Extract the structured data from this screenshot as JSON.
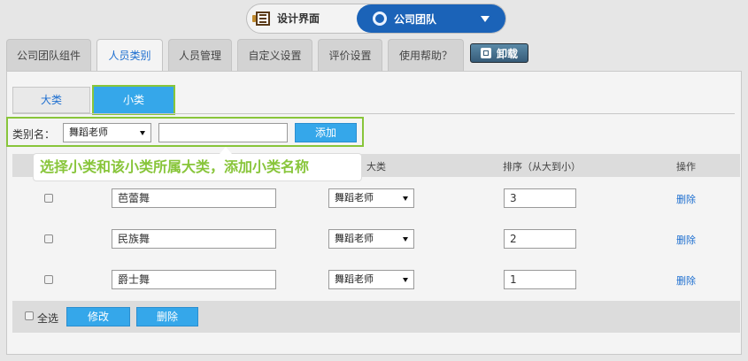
{
  "mode_switch": {
    "design_label": "设计界面",
    "team_label": "公司团队"
  },
  "tabs": [
    {
      "label": "公司团队组件"
    },
    {
      "label": "人员类别"
    },
    {
      "label": "人员管理"
    },
    {
      "label": "自定义设置"
    },
    {
      "label": "评价设置"
    },
    {
      "label": "使用帮助？"
    }
  ],
  "unload_label": "卸载",
  "subtabs": {
    "big": "大类",
    "small": "小类"
  },
  "form": {
    "label": "类别名：",
    "category_selected": "舞蹈老师",
    "name_value": "",
    "add_label": "添加"
  },
  "tooltip": "选择小类和该小类所属大类，添加小类名称",
  "table": {
    "headers": {
      "category": "大类",
      "order": "排序（从大到小）",
      "action": "操作"
    },
    "rows": [
      {
        "name": "芭蕾舞",
        "category": "舞蹈老师",
        "order": "3",
        "delete": "删除"
      },
      {
        "name": "民族舞",
        "category": "舞蹈老师",
        "order": "2",
        "delete": "删除"
      },
      {
        "name": "爵士舞",
        "category": "舞蹈老师",
        "order": "1",
        "delete": "删除"
      }
    ]
  },
  "footer": {
    "select_all": "全选",
    "modify": "修改",
    "delete": "删除"
  }
}
